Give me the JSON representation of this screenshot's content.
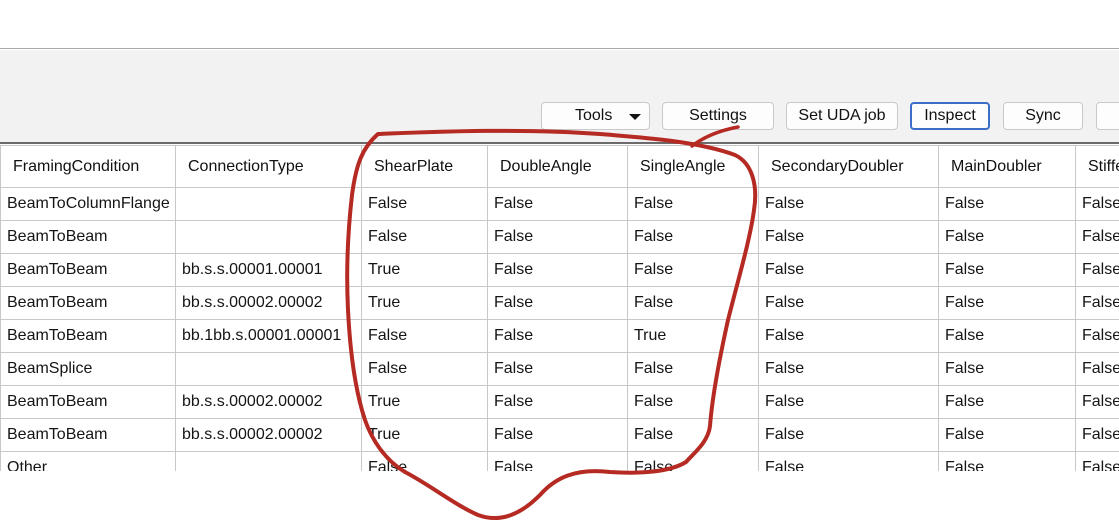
{
  "toolbar": {
    "tools_label": "Tools",
    "settings_label": "Settings",
    "set_uda_job_label": "Set UDA job",
    "inspect_label": "Inspect",
    "sync_label": "Sync"
  },
  "grid": {
    "columns": [
      "FramingCondition",
      "ConnectionType",
      "ShearPlate",
      "DoubleAngle",
      "SingleAngle",
      "SecondaryDoubler",
      "MainDoubler",
      "Stiffe"
    ],
    "rows": [
      [
        "BeamToColumnFlange",
        "",
        "False",
        "False",
        "False",
        "False",
        "False",
        "False"
      ],
      [
        "BeamToBeam",
        "",
        "False",
        "False",
        "False",
        "False",
        "False",
        "False"
      ],
      [
        "BeamToBeam",
        "bb.s.s.00001.00001",
        "True",
        "False",
        "False",
        "False",
        "False",
        "False"
      ],
      [
        "BeamToBeam",
        "bb.s.s.00002.00002",
        "True",
        "False",
        "False",
        "False",
        "False",
        "False"
      ],
      [
        "BeamToBeam",
        "bb.1bb.s.00001.00001",
        "False",
        "False",
        "True",
        "False",
        "False",
        "False"
      ],
      [
        "BeamSplice",
        "",
        "False",
        "False",
        "False",
        "False",
        "False",
        "False"
      ],
      [
        "BeamToBeam",
        "bb.s.s.00002.00002",
        "True",
        "False",
        "False",
        "False",
        "False",
        "False"
      ],
      [
        "BeamToBeam",
        "bb.s.s.00002.00002",
        "True",
        "False",
        "False",
        "False",
        "False",
        "False"
      ],
      [
        "Other",
        "",
        "False",
        "False",
        "False",
        "False",
        "False",
        "False"
      ]
    ]
  },
  "colors": {
    "annotation": "#b52a22",
    "active_button_border": "#3b6fc7",
    "grid_line": "#c8c8c8"
  }
}
